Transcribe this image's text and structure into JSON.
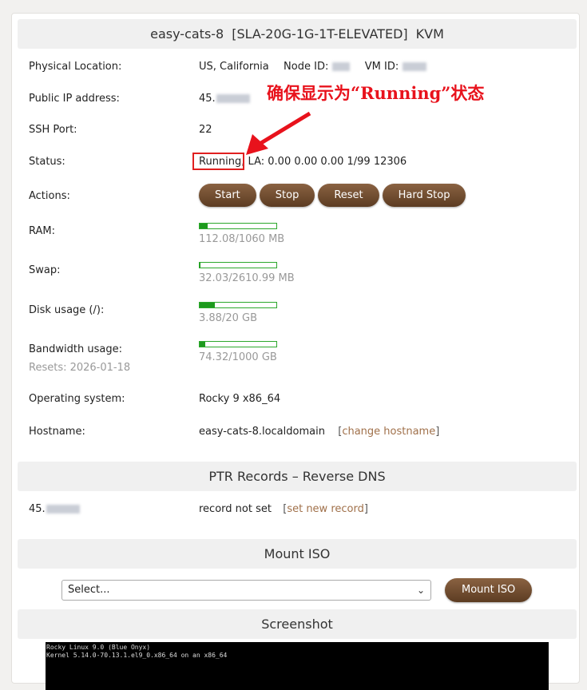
{
  "vps": {
    "header": {
      "name": "easy-cats-8",
      "plan": "[SLA-20G-1G-1T-ELEVATED]",
      "virt": "KVM"
    },
    "physical_location": {
      "label": "Physical Location:",
      "value": "US, California",
      "node_label": "Node ID:",
      "vm_label": "VM ID:"
    },
    "ip": {
      "label": "Public IP address:",
      "prefix": "45."
    },
    "ssh": {
      "label": "SSH Port:",
      "value": "22"
    },
    "status": {
      "label": "Status:",
      "running": "Running,",
      "la": "LA: 0.00 0.00 0.00 1/99 12306"
    },
    "actions": {
      "label": "Actions:",
      "start": "Start",
      "stop": "Stop",
      "reset": "Reset",
      "hard_stop": "Hard Stop"
    },
    "ram": {
      "label": "RAM:",
      "text": "112.08/1060 MB",
      "fraction": 0.106
    },
    "swap": {
      "label": "Swap:",
      "text": "32.03/2610.99 MB",
      "fraction": 0.012
    },
    "disk": {
      "label": "Disk usage (/):",
      "text": "3.88/20 GB",
      "fraction": 0.194
    },
    "bandwidth": {
      "label": "Bandwidth usage:",
      "resets": "Resets: 2026-01-18",
      "text": "74.32/1000 GB",
      "fraction": 0.074
    },
    "os": {
      "label": "Operating system:",
      "value": "Rocky 9 x86_64"
    },
    "hostname": {
      "label": "Hostname:",
      "value": "easy-cats-8.localdomain",
      "change_link": "change hostname"
    }
  },
  "ptr": {
    "header": "PTR Records – Reverse DNS",
    "ip_prefix": "45.",
    "value": "record not set",
    "set_link": "set new record"
  },
  "iso": {
    "header": "Mount ISO",
    "select_value": "Select...",
    "button": "Mount ISO"
  },
  "screenshot": {
    "header": "Screenshot",
    "line1": "Rocky Linux 9.0 (Blue Onyx)",
    "line2": "Kernel 5.14.0-70.13.1.el9_0.x86_64 on an x86_64"
  },
  "annotation": {
    "text": "确保显示为“Running”状态",
    "color": "#e8121c"
  },
  "colors": {
    "button_brown": "#6b4a2e",
    "bar_green": "#1d9a1d",
    "link": "#a0704a"
  }
}
